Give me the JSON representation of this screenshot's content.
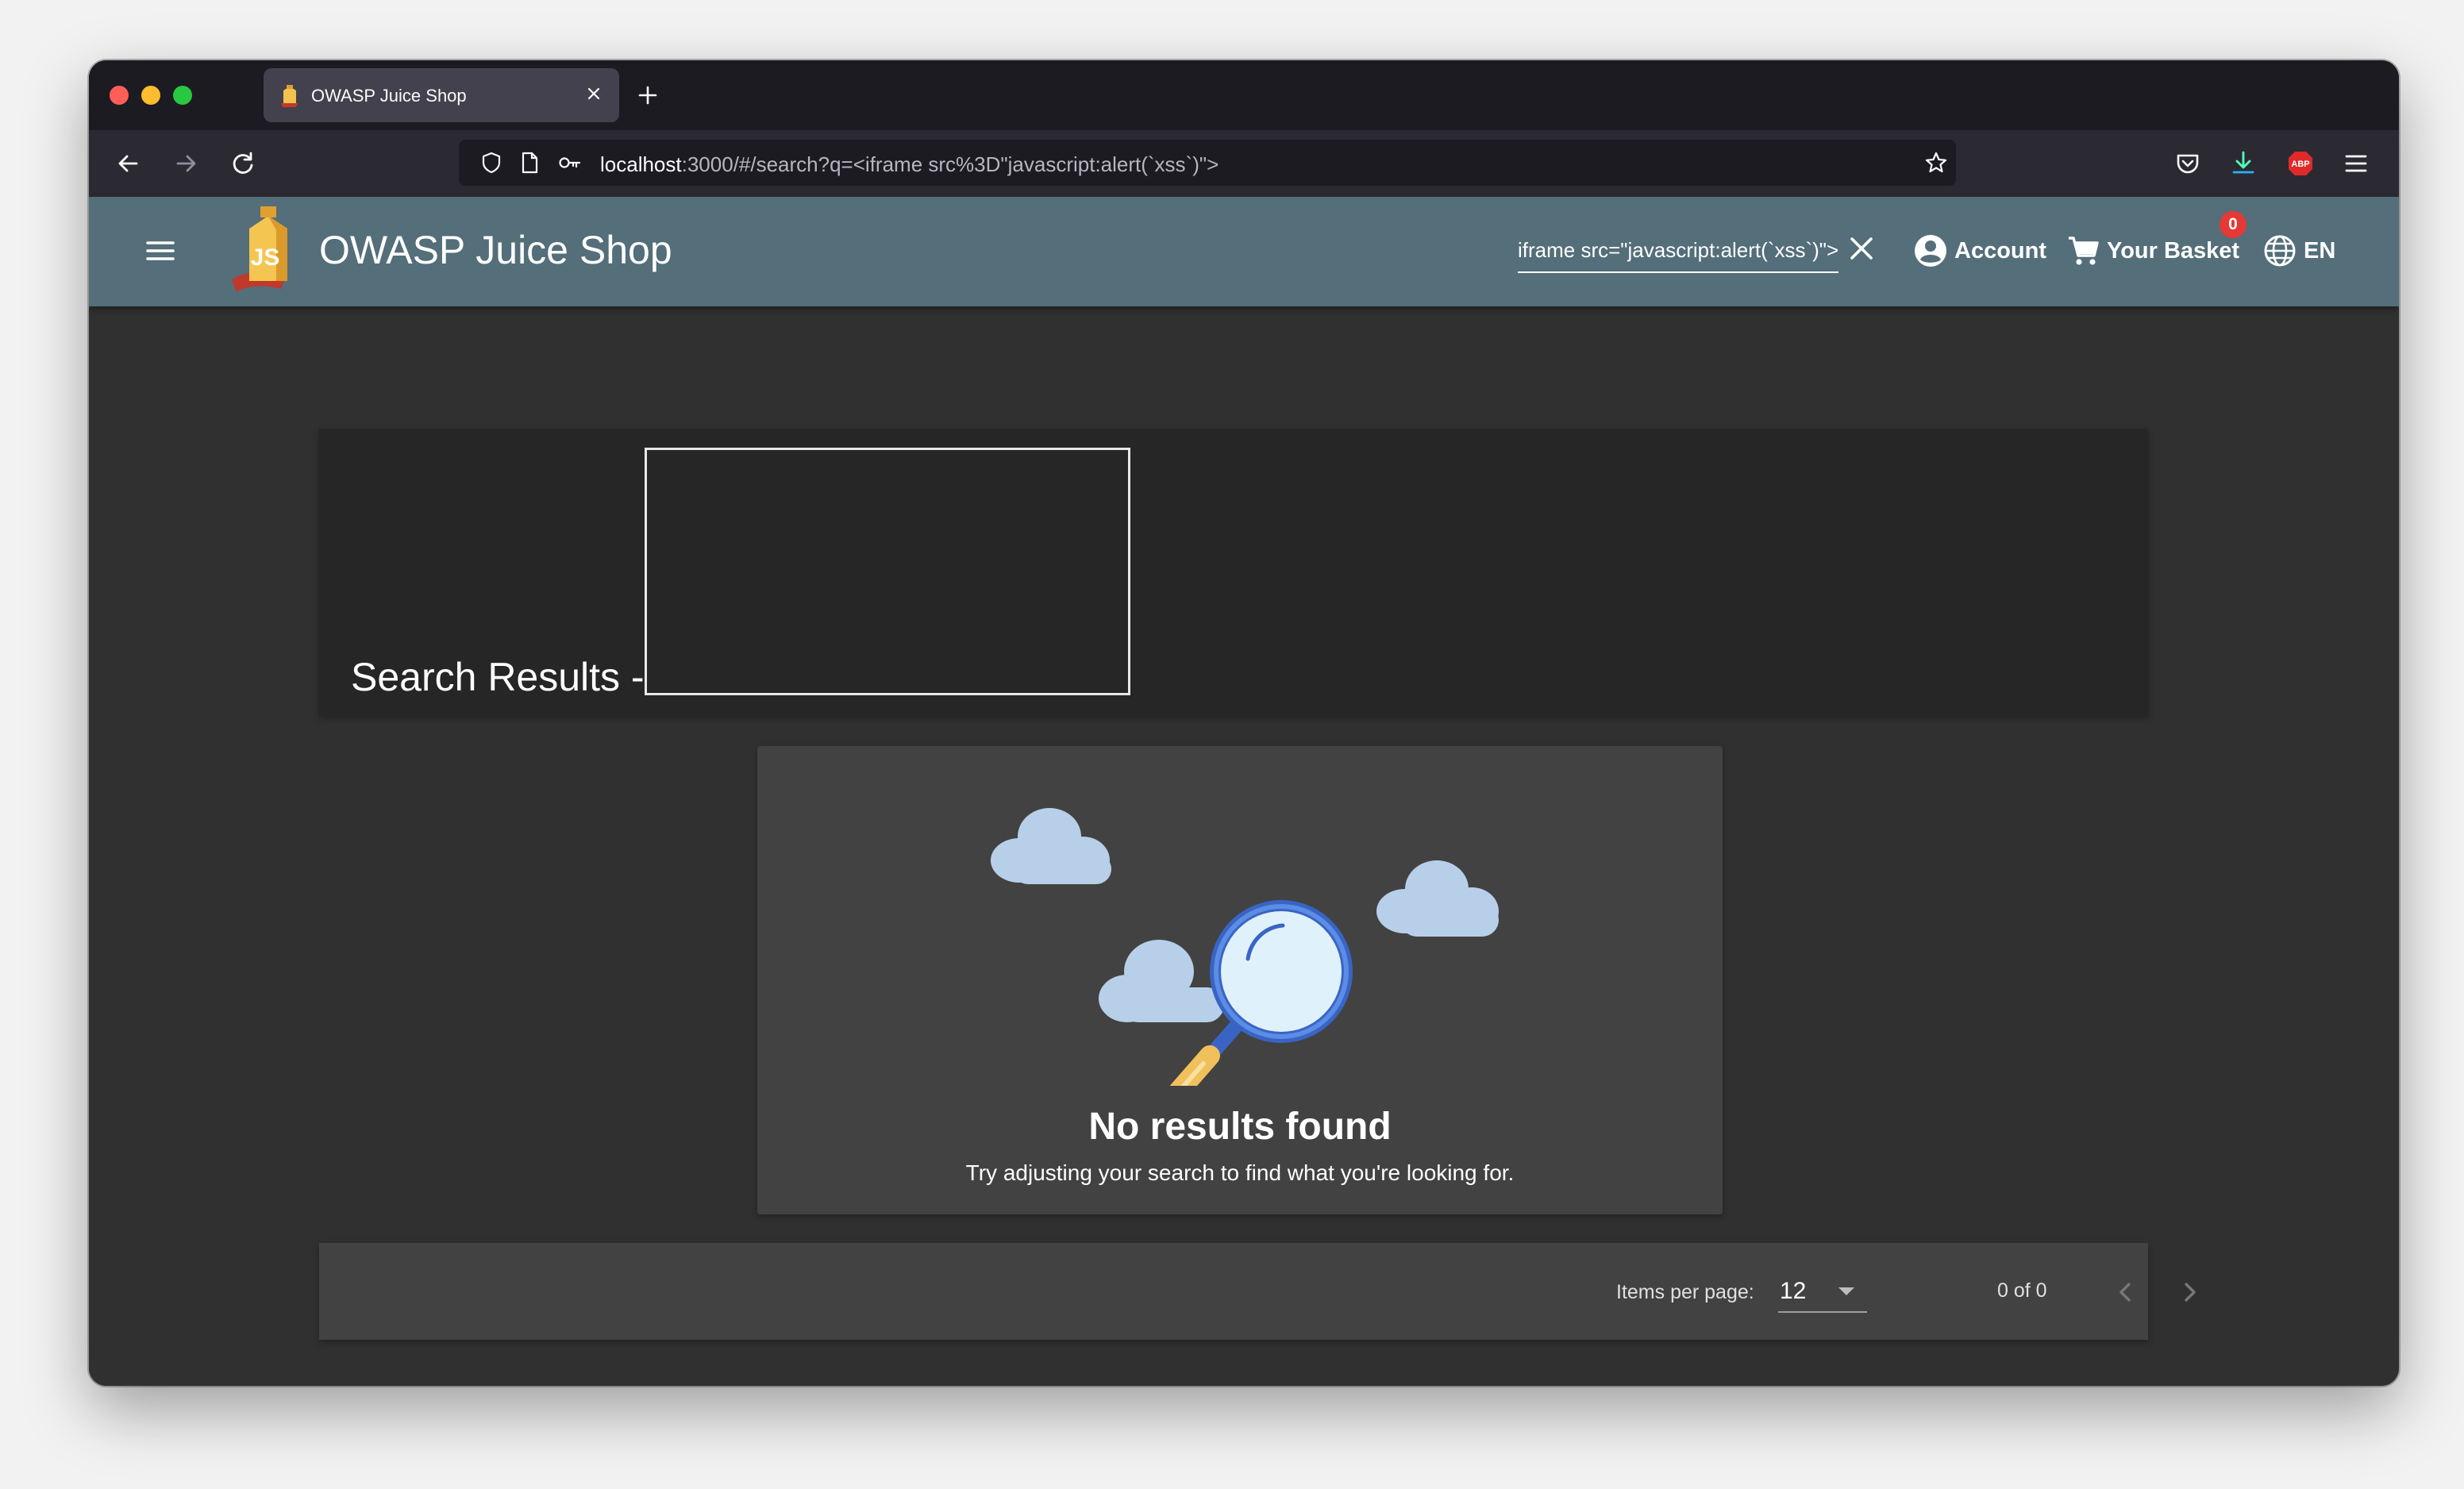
{
  "browser": {
    "tab_title": "OWASP Juice Shop",
    "url_host": "localhost",
    "url_rest": ":3000/#/search?q=<iframe src%3D\"javascript:alert(`xss`)\">"
  },
  "toolbar": {
    "app_title": "OWASP Juice Shop",
    "search_value": "iframe src=\"javascript:alert(`xss`)\">",
    "account_label": "Account",
    "basket_label": "Your Basket",
    "basket_count": "0",
    "language_label": "EN"
  },
  "results": {
    "heading": "Search Results -",
    "no_results_title": "No results found",
    "no_results_subtitle": "Try adjusting your search to find what you're looking for."
  },
  "paginator": {
    "items_per_page_label": "Items per page:",
    "items_per_page_value": "12",
    "range_label": "0 of 0"
  },
  "colors": {
    "toolbar": "#546e7a",
    "page_background": "#303030",
    "card": "#424242",
    "badge": "#e53935"
  }
}
